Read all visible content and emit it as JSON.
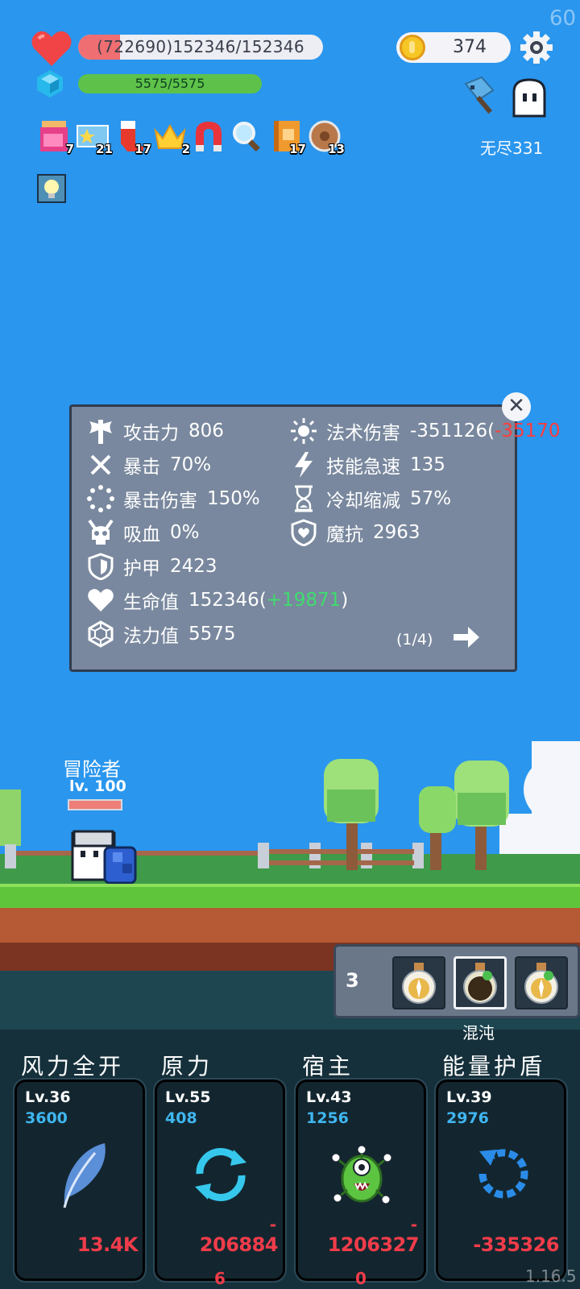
{
  "fps": "60",
  "version": "1.16.5",
  "hud": {
    "hp_text": "(722690)152346/152346",
    "hp_fill_fraction": 0.17,
    "mp_text": "5575/5575",
    "coins": "374",
    "endless_label": "无尽331"
  },
  "inventory": [
    {
      "icon": "jam-jar-icon",
      "count": "7"
    },
    {
      "icon": "star-card-icon",
      "count": "21"
    },
    {
      "icon": "red-sock-icon",
      "count": "17"
    },
    {
      "icon": "crown-icon",
      "count": "2"
    },
    {
      "icon": "magnet-icon",
      "count": ""
    },
    {
      "icon": "magnifier-icon",
      "count": ""
    },
    {
      "icon": "spellbook-icon",
      "count": "17"
    },
    {
      "icon": "round-shield-icon",
      "count": "13"
    }
  ],
  "stats": {
    "left": [
      {
        "icon": "axe-icon",
        "label": "攻击力",
        "value": "806",
        "bonus": ""
      },
      {
        "icon": "crit-icon",
        "label": "暴击",
        "value": "70%",
        "bonus": ""
      },
      {
        "icon": "crit-damage-icon",
        "label": "暴击伤害",
        "value": "150%",
        "bonus": ""
      },
      {
        "icon": "vampire-skull-icon",
        "label": "吸血",
        "value": "0%",
        "bonus": ""
      },
      {
        "icon": "armor-shield-icon",
        "label": "护甲",
        "value": "2423",
        "bonus": ""
      },
      {
        "icon": "heart-icon",
        "label": "生命值",
        "value": "152346",
        "bonus": "+19871"
      },
      {
        "icon": "mana-crystal-icon",
        "label": "法力值",
        "value": "5575",
        "bonus": ""
      }
    ],
    "right": [
      {
        "icon": "sun-icon",
        "label": "法术伤害",
        "value": "-351126",
        "bonus": "-35170"
      },
      {
        "icon": "lightning-icon",
        "label": "技能急速",
        "value": "135",
        "bonus": ""
      },
      {
        "icon": "hourglass-icon",
        "label": "冷却缩减",
        "value": "57%",
        "bonus": ""
      },
      {
        "icon": "magic-shield-icon",
        "label": "魔抗",
        "value": "2963",
        "bonus": ""
      }
    ],
    "page": "(1/4)",
    "close_glyph": "✕"
  },
  "hero": {
    "name": "冒险者",
    "level": "lv. 100"
  },
  "potions": {
    "count": "3",
    "selected_name": "混沌",
    "slots": [
      "golden-potion-icon",
      "dark-potion-icon",
      "golden-potion-icon"
    ]
  },
  "skills": [
    {
      "name": "风力全开",
      "level": "Lv.36",
      "value": "3600",
      "icon": "feather-icon",
      "damage": "13.4K",
      "damage_prefix": "",
      "damage_wrap": ""
    },
    {
      "name": "原力",
      "level": "Lv.55",
      "value": "408",
      "icon": "cycle-arrows-icon",
      "damage": "206884",
      "damage_prefix": "-",
      "damage_wrap": "6"
    },
    {
      "name": "宿主",
      "level": "Lv.43",
      "value": "1256",
      "icon": "green-monster-icon",
      "damage": "1206327",
      "damage_prefix": "-",
      "damage_wrap": "0"
    },
    {
      "name": "能量护盾",
      "level": "Lv.39",
      "value": "2976",
      "icon": "dashed-refresh-icon",
      "damage": "-335326",
      "damage_prefix": "",
      "damage_wrap": ""
    }
  ],
  "colors": {
    "sky": "#2a96ee",
    "panel": "#79889e",
    "hp": "#ef6e72",
    "mp": "#5ec24a",
    "bonus_green": "#3fdc6e",
    "damage_red": "#f03c4a",
    "skill_value_blue": "#3fb6f0"
  }
}
